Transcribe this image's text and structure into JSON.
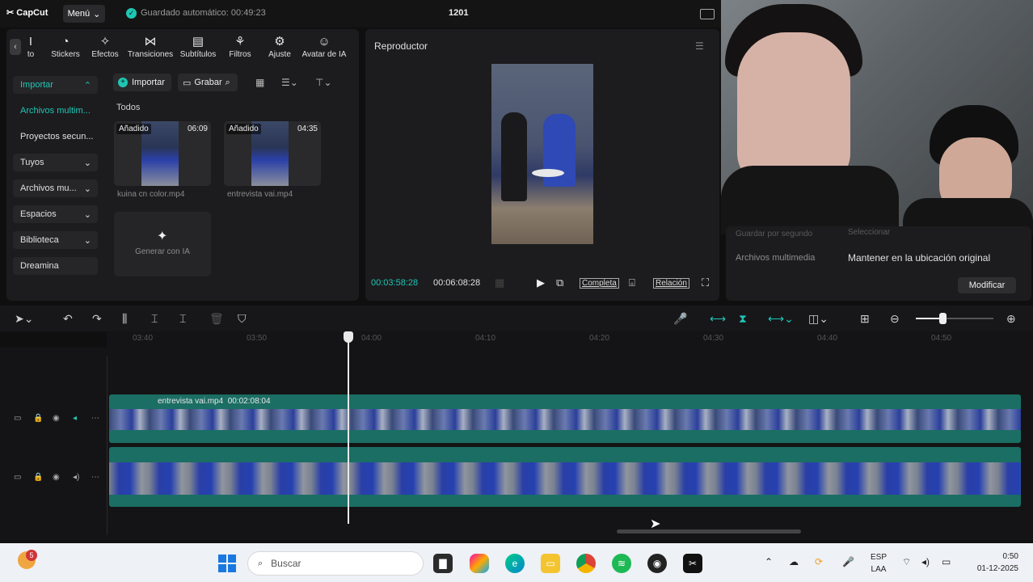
{
  "titlebar": {
    "logo": "CapCut",
    "menu_label": "Menú",
    "autosave": "Guardado automático: 00:49:23",
    "project_name": "1201"
  },
  "toolbar": {
    "tools": [
      {
        "label": "to",
        "icon": "text-icon"
      },
      {
        "label": "Stickers",
        "icon": "sticker-icon"
      },
      {
        "label": "Efectos",
        "icon": "effects-icon"
      },
      {
        "label": "Transiciones",
        "icon": "transition-icon"
      },
      {
        "label": "Subtítulos",
        "icon": "captions-icon"
      },
      {
        "label": "Filtros",
        "icon": "filters-icon"
      },
      {
        "label": "Ajuste",
        "icon": "adjust-icon"
      },
      {
        "label": "Avatar de IA",
        "icon": "avatar-icon"
      }
    ]
  },
  "sidebar": {
    "items": [
      {
        "label": "Importar"
      },
      {
        "label": "Archivos multim..."
      },
      {
        "label": "Proyectos secun..."
      },
      {
        "label": "Tuyos"
      },
      {
        "label": "Archivos mu..."
      },
      {
        "label": "Espacios"
      },
      {
        "label": "Biblioteca"
      },
      {
        "label": "Dreamina"
      }
    ]
  },
  "media": {
    "import_label": "Importar",
    "record_label": "Grabar",
    "filter_label": "Todos",
    "clips": [
      {
        "badge": "Añadido",
        "duration": "06:09",
        "name": "kuina cn color.mp4"
      },
      {
        "badge": "Añadido",
        "duration": "04:35",
        "name": "entrevista vai.mp4"
      }
    ],
    "generate_label": "Generar con IA"
  },
  "player": {
    "title": "Reproductor",
    "current_time": "00:03:58:28",
    "total_time": "00:06:08:28",
    "full_label": "Completa",
    "ratio_label": "Relación"
  },
  "details": {
    "top_left": "Guardar por segundo",
    "top_right": "Seleccionar",
    "media_label": "Archivos multimedia",
    "media_value": "Mantener en la ubicación original",
    "modify_label": "Modificar"
  },
  "timeline": {
    "ticks": [
      "03:40",
      "03:50",
      "04:00",
      "04:10",
      "04:20",
      "04:30",
      "04:40",
      "04:50"
    ],
    "track1_name": "entrevista vai.mp4",
    "track1_duration": "00:02:08:04"
  },
  "taskbar": {
    "weather_badge": "5",
    "search_placeholder": "Buscar",
    "lang_top": "ESP",
    "lang_bottom": "LAA",
    "time": "0:50",
    "date": "01-12-2025"
  },
  "colors": {
    "accent": "#1fc6b5",
    "track": "#1b6e64",
    "panel": "#1c1c1e"
  }
}
